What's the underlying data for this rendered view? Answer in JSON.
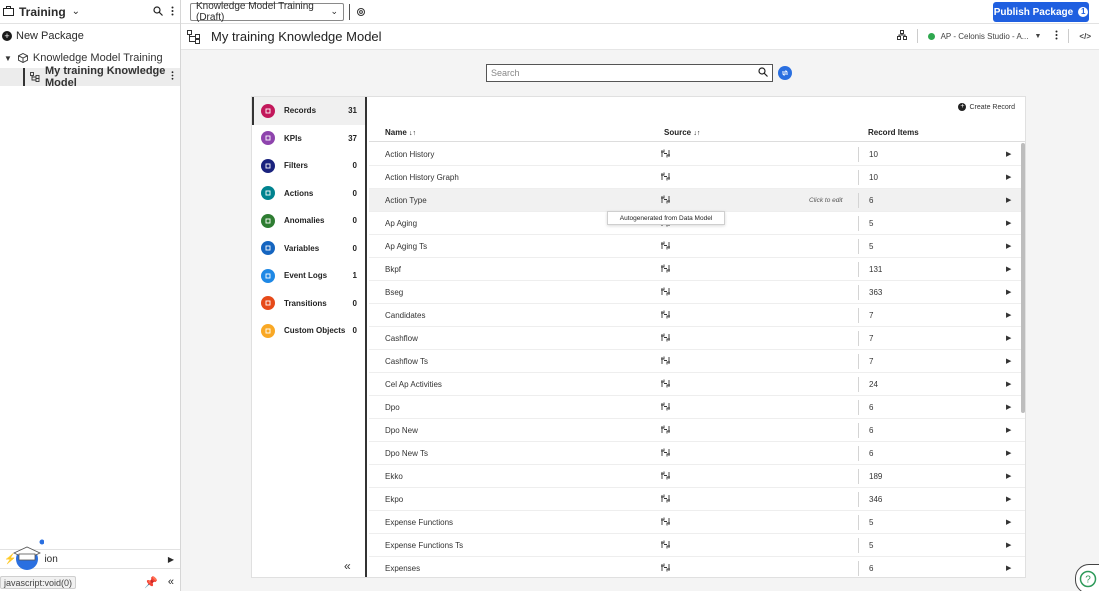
{
  "sidebar": {
    "title": "Training",
    "new_package": "New Package",
    "tree": [
      {
        "label": "Knowledge Model Training"
      },
      {
        "label": "My training Knowledge Model"
      }
    ],
    "bottom_item": "ion",
    "status_url": "javascript:void(0)"
  },
  "topbar": {
    "version_select": "Knowledge Model Training (Draft)",
    "publish_label": "Publish Package",
    "publish_count": "1"
  },
  "header": {
    "title": "My training Knowledge Model",
    "connection": "AP - Celonis Studio - A..."
  },
  "search": {
    "placeholder": "Search"
  },
  "categories": [
    {
      "label": "Records",
      "count": "31",
      "color": "#c2185b",
      "icon": "records-icon"
    },
    {
      "label": "KPIs",
      "count": "37",
      "color": "#8e44ad",
      "icon": "kpi-icon"
    },
    {
      "label": "Filters",
      "count": "0",
      "color": "#1a237e",
      "icon": "filter-icon"
    },
    {
      "label": "Actions",
      "count": "0",
      "color": "#00838f",
      "icon": "actions-icon"
    },
    {
      "label": "Anomalies",
      "count": "0",
      "color": "#2e7d32",
      "icon": "anomalies-icon"
    },
    {
      "label": "Variables",
      "count": "0",
      "color": "#1565c0",
      "icon": "variables-icon"
    },
    {
      "label": "Event Logs",
      "count": "1",
      "color": "#1e88e5",
      "icon": "event-logs-icon"
    },
    {
      "label": "Transitions",
      "count": "0",
      "color": "#e64a19",
      "icon": "transitions-icon"
    },
    {
      "label": "Custom Objects",
      "count": "0",
      "color": "#f9a825",
      "icon": "custom-objects-icon"
    }
  ],
  "table": {
    "create_label": "Create Record",
    "headers": {
      "name": "Name",
      "source": "Source",
      "items": "Record Items"
    },
    "click_to_edit": "Click to edit",
    "tooltip": "Autogenerated from Data Model",
    "rows": [
      {
        "name": "Action History",
        "items": "10"
      },
      {
        "name": "Action History Graph",
        "items": "10"
      },
      {
        "name": "Action Type",
        "items": "6"
      },
      {
        "name": "Ap Aging",
        "items": "5"
      },
      {
        "name": "Ap Aging Ts",
        "items": "5"
      },
      {
        "name": "Bkpf",
        "items": "131"
      },
      {
        "name": "Bseg",
        "items": "363"
      },
      {
        "name": "Candidates",
        "items": "7"
      },
      {
        "name": "Cashflow",
        "items": "7"
      },
      {
        "name": "Cashflow Ts",
        "items": "7"
      },
      {
        "name": "Cel Ap Activities",
        "items": "24"
      },
      {
        "name": "Dpo",
        "items": "6"
      },
      {
        "name": "Dpo New",
        "items": "6"
      },
      {
        "name": "Dpo New Ts",
        "items": "6"
      },
      {
        "name": "Ekko",
        "items": "189"
      },
      {
        "name": "Ekpo",
        "items": "346"
      },
      {
        "name": "Expense Functions",
        "items": "5"
      },
      {
        "name": "Expense Functions Ts",
        "items": "5"
      },
      {
        "name": "Expenses",
        "items": "6"
      }
    ]
  },
  "colors": {
    "accent": "#1f5fe0",
    "connected": "#2fa84f"
  }
}
